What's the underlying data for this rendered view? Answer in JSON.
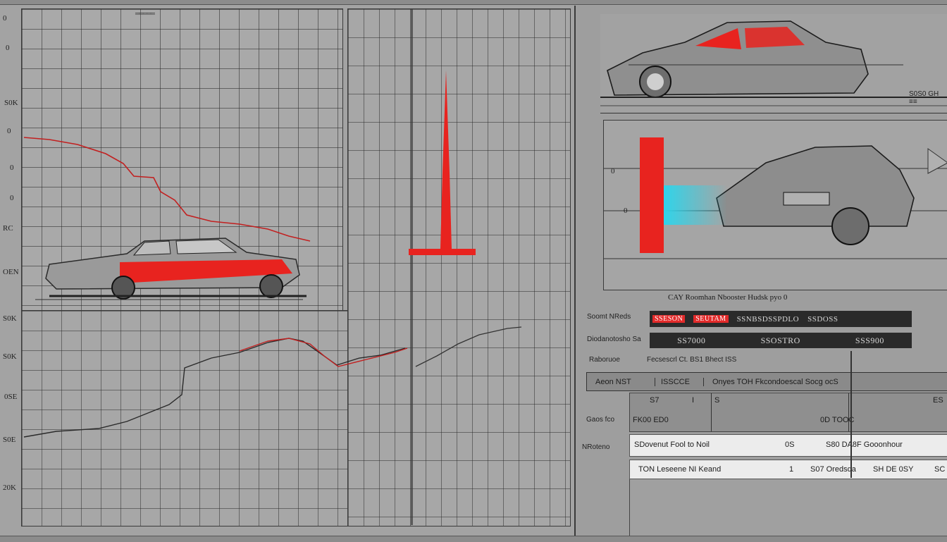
{
  "left_chart": {
    "header_label": "═════",
    "y_ticks": [
      "0",
      "0",
      "S0K",
      "0",
      "0",
      "0",
      "RC",
      "OEN",
      "S0K",
      "S0K",
      "0SE",
      "S0E",
      "20K"
    ]
  },
  "right_panel": {
    "top_caption": "S0S0 GH ≡≡",
    "side_ticks": [
      "0",
      "0"
    ],
    "caption_line": "CAY Roomhan Nbooster Hudsk pyo 0",
    "row1_label": "Soomt NReds",
    "row1_cells": [
      "SSESON",
      "SEUTAM",
      "SSNBSDSSPDLO",
      "SSDOSS"
    ],
    "row2_label": "Diodanotosho Sa",
    "row2_values": [
      "SS7000",
      "SSOSTRO",
      "SSS900"
    ],
    "row3_label": "Raboruoe",
    "row3_value": "Fecsescrl Ct. BS1 Bhect ISS",
    "table": {
      "header": [
        "Aeon NST",
        "ISSCCE",
        "Onyes TOH Fkcondoescal Socg ocS"
      ],
      "rows": [
        {
          "label": "Gaos fco",
          "cells": [
            "S7",
            "I",
            "S",
            "",
            "ES"
          ],
          "sub": [
            "FK00 ED0",
            "0D TOOC"
          ]
        },
        {
          "label": "NRoteno",
          "cells": [
            "SDovenut Fool to Noil",
            "0S",
            "S80 DA8F Gooonhour"
          ]
        },
        {
          "label": "",
          "cells": [
            "TON Leseene NI Keand",
            "1",
            "S07 Oredsda",
            "SH DE 0SY",
            "SC"
          ]
        }
      ]
    }
  },
  "colors": {
    "accent_red": "#e8231f",
    "accent_cyan": "#2fd4ea",
    "grid_bg": "#a8a8a8",
    "dark_cell": "#2a2a2a"
  }
}
